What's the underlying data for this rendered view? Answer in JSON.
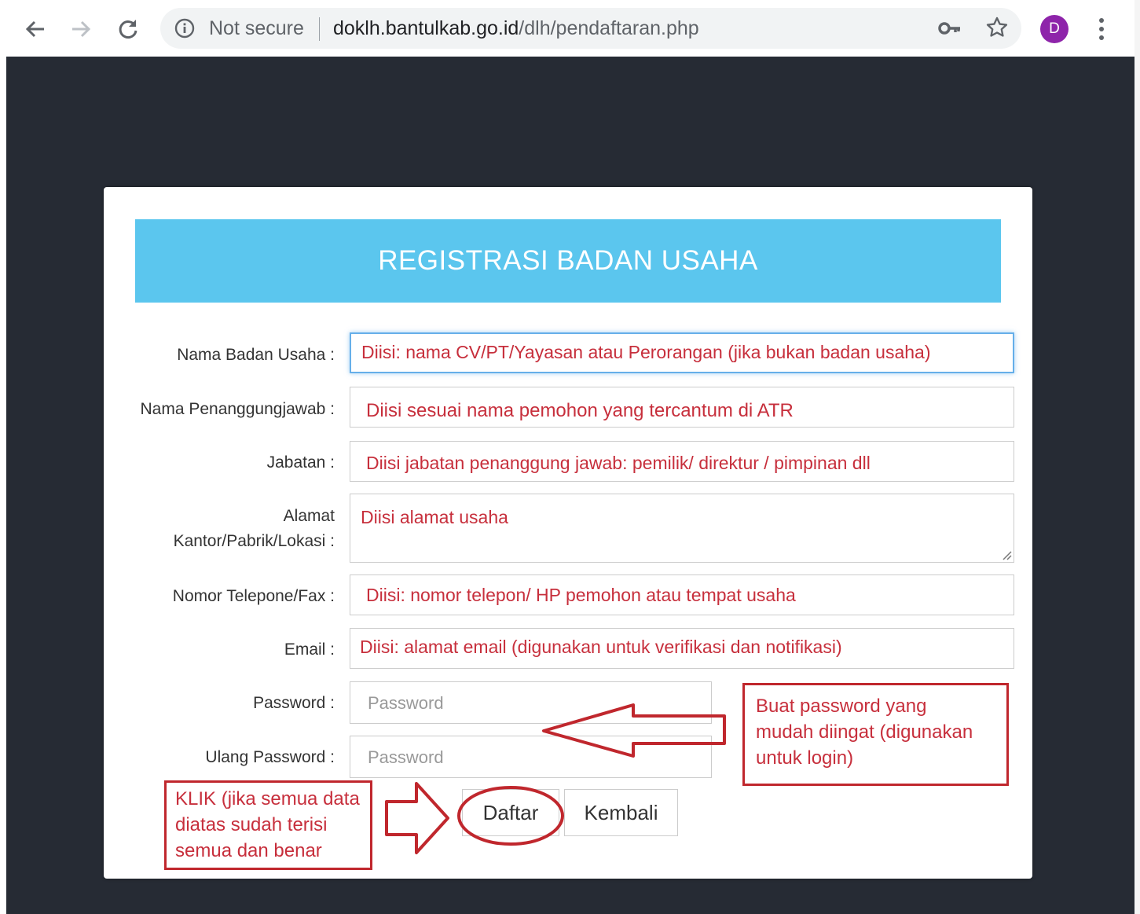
{
  "browser": {
    "security_label": "Not secure",
    "url_host": "doklh.bantulkab.go.id",
    "url_path": "/dlh/pendaftaran.php",
    "profile_initial": "D",
    "profile_color": "#8e24aa",
    "icons": [
      "back-arrow-icon",
      "forward-arrow-icon",
      "reload-icon",
      "info-icon",
      "key-icon",
      "star-icon",
      "menu-dots-icon"
    ]
  },
  "form": {
    "title": "REGISTRASI BADAN USAHA",
    "banner_color": "#5bc6ee",
    "fields": [
      {
        "label": "Nama Badan Usaha :",
        "value": "Diisi: nama CV/PT/Yayasan atau Perorangan (jika bukan badan usaha)"
      },
      {
        "label": "Nama Penanggungjawab :",
        "value": "Diisi sesuai nama pemohon yang tercantum di ATR"
      },
      {
        "label": "Jabatan :",
        "value": "Diisi jabatan penanggung jawab: pemilik/ direktur / pimpinan dll"
      },
      {
        "label_line1": "Alamat",
        "label_line2": "Kantor/Pabrik/Lokasi :",
        "value": "Diisi alamat usaha"
      },
      {
        "label": "Nomor Telepone/Fax :",
        "value": "Diisi: nomor telepon/ HP pemohon atau tempat usaha"
      },
      {
        "label": "Email :",
        "value": "Diisi: alamat email (digunakan untuk verifikasi dan notifikasi)"
      },
      {
        "label": "Password :",
        "placeholder": "Password"
      },
      {
        "label": "Ulang Password :",
        "placeholder": "Password"
      }
    ],
    "buttons": {
      "submit": "Daftar",
      "back": "Kembali"
    }
  },
  "annotations": {
    "password_note_lines": [
      "Buat password yang",
      "mudah diingat (digunakan",
      "untuk login)"
    ],
    "click_note_lines": [
      "KLIK (jika semua data",
      "diatas sudah terisi",
      "semua dan benar"
    ],
    "color": "#c0272d"
  }
}
